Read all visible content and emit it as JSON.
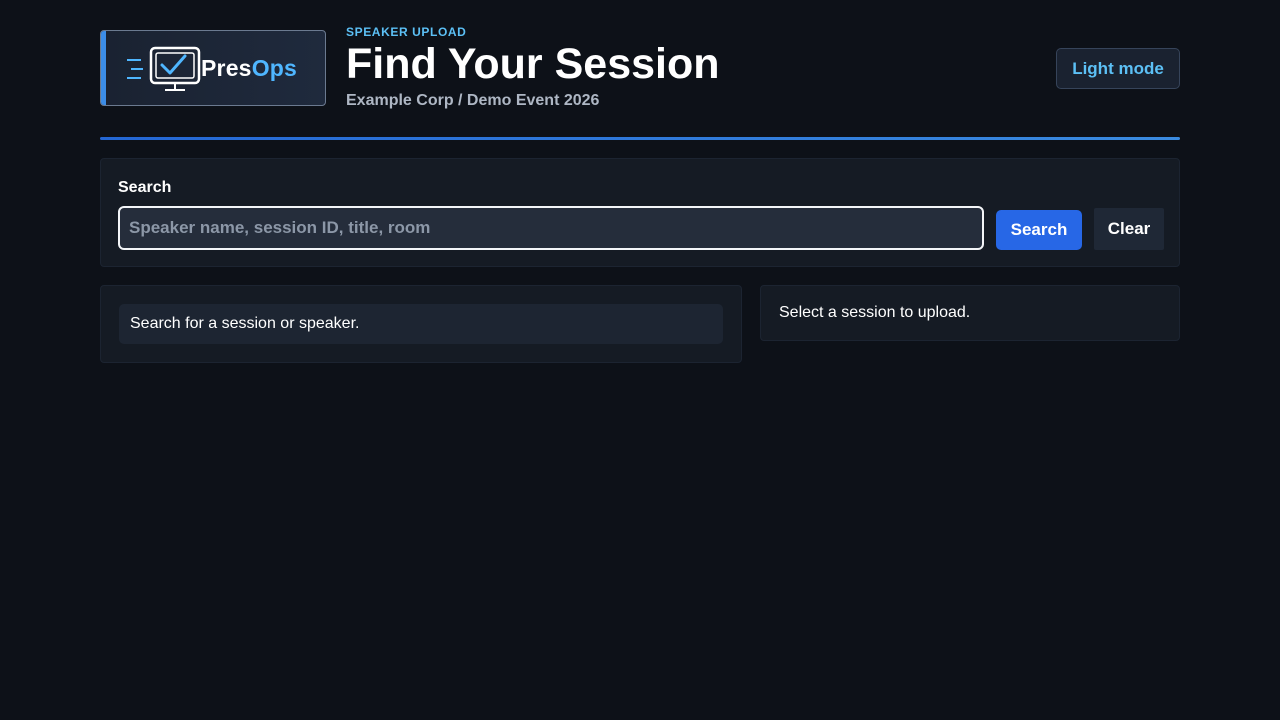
{
  "brand": {
    "word_part1": "Pres",
    "word_part2": "Ops",
    "accent_color": "#4fb6ff",
    "icon": "monitor-check-icon"
  },
  "header": {
    "eyebrow": "SPEAKER UPLOAD",
    "title": "Find Your Session",
    "subtitle": "Example Corp / Demo Event 2026",
    "theme_toggle_label": "Light mode"
  },
  "search": {
    "label": "Search",
    "placeholder": "Speaker name, session ID, title, room",
    "value": "",
    "search_button_label": "Search",
    "clear_button_label": "Clear"
  },
  "results": {
    "empty_message": "Search for a session or speaker."
  },
  "upload": {
    "empty_message": "Select a session to upload."
  },
  "colors": {
    "background": "#0d1118",
    "panel": "#151b24",
    "primary_button": "#2767e6",
    "link_accent": "#5cc0f5"
  }
}
